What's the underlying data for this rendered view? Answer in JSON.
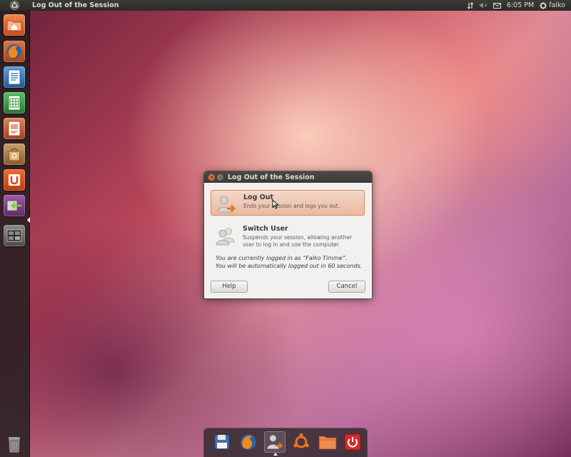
{
  "top_panel": {
    "window_title": "Log Out of the Session",
    "clock": "6:05 PM",
    "user": "falko"
  },
  "launcher": {
    "items": [
      {
        "name": "home-folder",
        "color": "#e0622d"
      },
      {
        "name": "firefox",
        "color": "#e66000"
      },
      {
        "name": "libreoffice-writer",
        "color": "#2a6fb5"
      },
      {
        "name": "libreoffice-calc",
        "color": "#2f9a3a"
      },
      {
        "name": "libreoffice-impress",
        "color": "#c7532b"
      },
      {
        "name": "ubuntu-software-center",
        "color": "#c9853f"
      },
      {
        "name": "ubuntu-one",
        "color": "#dd4814"
      },
      {
        "name": "log-out-dialog",
        "color": "#7c3f85"
      },
      {
        "name": "workspace-switcher",
        "color": "#6a6a6a"
      }
    ]
  },
  "dialog": {
    "title": "Log Out of the Session",
    "options": [
      {
        "label": "Log Out",
        "description": "Ends your session and logs you out."
      },
      {
        "label": "Switch User",
        "description": "Suspends your session, allowing another user to log in and use the computer."
      }
    ],
    "info_line1": "You are currently logged in as “Falko Timme”.",
    "info_line2": "You will be automatically logged out in 60 seconds.",
    "help_label": "Help",
    "cancel_label": "Cancel"
  },
  "colors": {
    "accent": "#dd4814",
    "panel": "#3c3b37",
    "dialog_bg": "#f2f1f0"
  }
}
